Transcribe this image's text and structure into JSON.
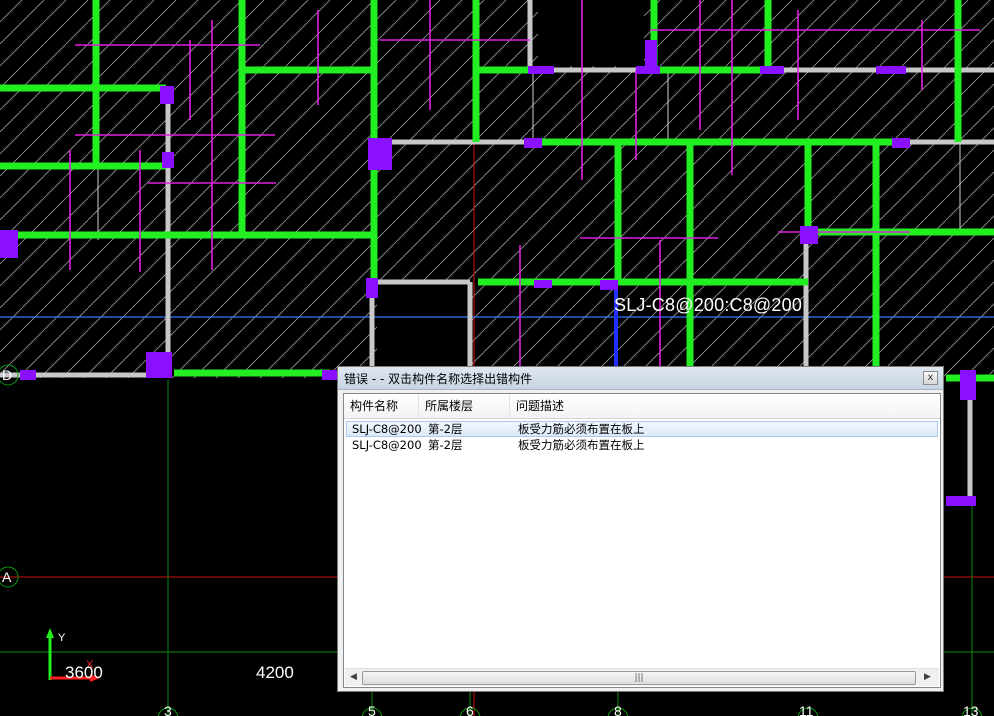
{
  "canvas": {
    "annotation": "SLJ-C8@200:C8@200",
    "dimensions": [
      "3600",
      "4200"
    ],
    "axis_y_label": "Y",
    "axis_x_label": "X",
    "grid_labels": {
      "D": "D",
      "A": "A",
      "c3": "3",
      "c5": "5",
      "c6": "6",
      "c8": "8",
      "c11": "11",
      "c13": "13"
    }
  },
  "dialog": {
    "title": "错误 - - 双击构件名称选择出错构件",
    "close_glyph": "x",
    "columns": [
      "构件名称",
      "所属楼层",
      "问题描述"
    ],
    "rows": [
      {
        "name": "SLJ-C8@200",
        "floor": "第-2层",
        "issue": "板受力筋必须布置在板上",
        "selected": true
      },
      {
        "name": "SLJ-C8@200",
        "floor": "第-2层",
        "issue": "板受力筋必须布置在板上",
        "selected": false
      }
    ],
    "scroll_left": "◀",
    "scroll_right": "▶",
    "scroll_grip": "|||"
  },
  "colors": {
    "beam": "#00ff00",
    "rebar": "#ff00ff",
    "column": "#8000ff",
    "axis": "#00a000",
    "gridline": "#ff0000"
  }
}
